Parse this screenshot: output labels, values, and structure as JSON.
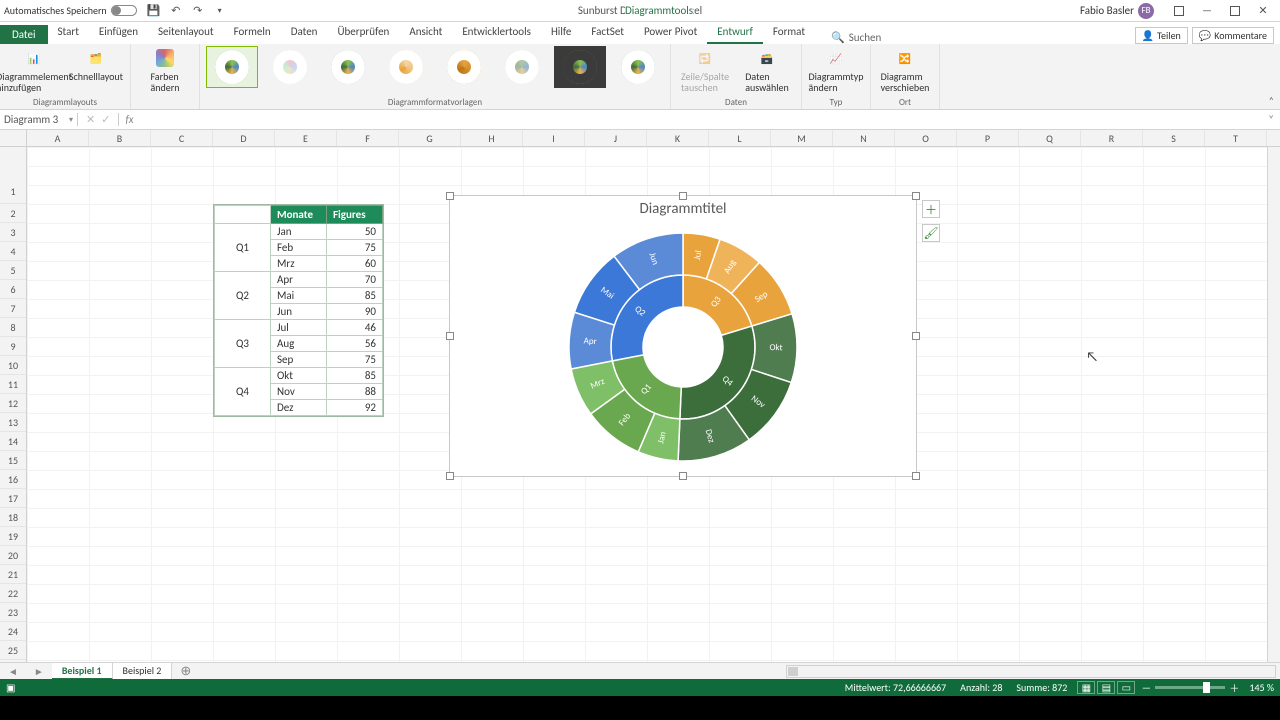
{
  "titlebar": {
    "autosave_label": "Automatisches Speichern",
    "doc_title": "Sunburst Diagramm",
    "app_name": "Excel",
    "tool_tab": "Diagrammtools",
    "user_name": "Fabio Basler",
    "user_initials": "FB"
  },
  "tabs": {
    "file": "Datei",
    "items": [
      "Start",
      "Einfügen",
      "Seitenlayout",
      "Formeln",
      "Daten",
      "Überprüfen",
      "Ansicht",
      "Entwicklertools",
      "Hilfe",
      "FactSet",
      "Power Pivot",
      "Entwurf",
      "Format"
    ],
    "active": "Entwurf",
    "search_placeholder": "Suchen",
    "share": "Teilen",
    "comments": "Kommentare"
  },
  "ribbon": {
    "g1": {
      "btn1": "Diagrammelement\nhinzufügen",
      "btn2": "Schnelllayout",
      "label": "Diagrammlayouts"
    },
    "g2": {
      "btn": "Farben\nändern"
    },
    "g3": {
      "label": "Diagrammformatvorlagen"
    },
    "g4": {
      "btn1": "Zeile/Spalte\ntauschen",
      "btn2": "Daten\nauswählen",
      "label": "Daten"
    },
    "g5": {
      "btn": "Diagrammtyp\nändern",
      "label": "Typ"
    },
    "g6": {
      "btn": "Diagramm\nverschieben",
      "label": "Ort"
    }
  },
  "namebox": "Diagramm 3",
  "fx_label": "fx",
  "columns": [
    "A",
    "B",
    "C",
    "D",
    "E",
    "F",
    "G",
    "H",
    "I",
    "J",
    "K",
    "L",
    "M",
    "N",
    "O",
    "P",
    "Q",
    "R",
    "S",
    "T"
  ],
  "row_count": 24,
  "table": {
    "hdr_month": "Monate",
    "hdr_fig": "Figures",
    "quarters": [
      "Q1",
      "Q2",
      "Q3",
      "Q4"
    ],
    "rows": [
      {
        "m": "Jan",
        "v": 50
      },
      {
        "m": "Feb",
        "v": 75
      },
      {
        "m": "Mrz",
        "v": 60
      },
      {
        "m": "Apr",
        "v": 70
      },
      {
        "m": "Mai",
        "v": 85
      },
      {
        "m": "Jun",
        "v": 90
      },
      {
        "m": "Jul",
        "v": 46
      },
      {
        "m": "Aug",
        "v": 56
      },
      {
        "m": "Sep",
        "v": 75
      },
      {
        "m": "Okt",
        "v": 85
      },
      {
        "m": "Nov",
        "v": 88
      },
      {
        "m": "Dez",
        "v": 92
      }
    ]
  },
  "chart": {
    "title": "Diagrammtitel"
  },
  "chart_data": {
    "type": "sunburst",
    "title": "Diagrammtitel",
    "inner": [
      {
        "name": "Q1",
        "value": 185,
        "color": "#6aa84f"
      },
      {
        "name": "Q2",
        "value": 245,
        "color": "#3c78d8"
      },
      {
        "name": "Q3",
        "value": 177,
        "color": "#e8a33d"
      },
      {
        "name": "Q4",
        "value": 265,
        "color": "#3b6e3b"
      }
    ],
    "outer": [
      {
        "parent": "Q1",
        "name": "Jan",
        "value": 50,
        "color": "#7fbf67"
      },
      {
        "parent": "Q1",
        "name": "Feb",
        "value": 75,
        "color": "#6aa84f"
      },
      {
        "parent": "Q1",
        "name": "Mrz",
        "value": 60,
        "color": "#7fbf67"
      },
      {
        "parent": "Q2",
        "name": "Apr",
        "value": 70,
        "color": "#5b8bd6"
      },
      {
        "parent": "Q2",
        "name": "Mai",
        "value": 85,
        "color": "#3c78d8"
      },
      {
        "parent": "Q2",
        "name": "Jun",
        "value": 90,
        "color": "#5b8bd6"
      },
      {
        "parent": "Q3",
        "name": "Jul",
        "value": 46,
        "color": "#e8a33d"
      },
      {
        "parent": "Q3",
        "name": "Aug",
        "value": 56,
        "color": "#efb45a"
      },
      {
        "parent": "Q3",
        "name": "Sep",
        "value": 75,
        "color": "#e8a33d"
      },
      {
        "parent": "Q4",
        "name": "Okt",
        "value": 85,
        "color": "#4f7d4f"
      },
      {
        "parent": "Q4",
        "name": "Nov",
        "value": 88,
        "color": "#3b6e3b"
      },
      {
        "parent": "Q4",
        "name": "Dez",
        "value": 92,
        "color": "#4f7d4f"
      }
    ],
    "total": 872
  },
  "sheets": {
    "active": "Beispiel 1",
    "tabs": [
      "Beispiel 1",
      "Beispiel 2"
    ]
  },
  "statusbar": {
    "avg_label": "Mittelwert:",
    "avg": "72,66666667",
    "count_label": "Anzahl:",
    "count": "28",
    "sum_label": "Summe:",
    "sum": "872",
    "zoom": "145 %"
  }
}
